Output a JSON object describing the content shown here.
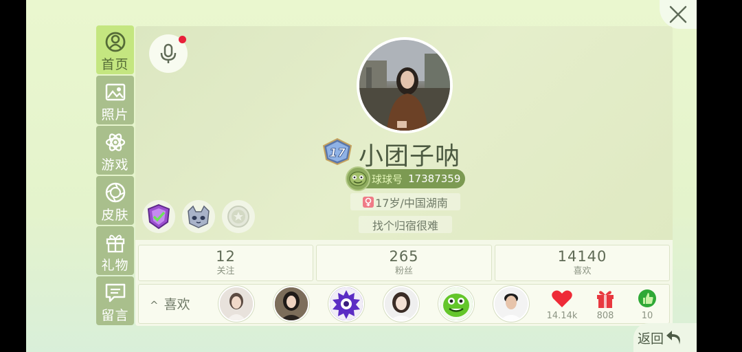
{
  "sidebar": {
    "items": [
      {
        "label": "首页",
        "icon": "user-circle-icon",
        "active": true
      },
      {
        "label": "照片",
        "icon": "photo-icon",
        "active": false
      },
      {
        "label": "游戏",
        "icon": "atom-icon",
        "active": false
      },
      {
        "label": "皮肤",
        "icon": "palette-icon",
        "active": false
      },
      {
        "label": "礼物",
        "icon": "gift-icon",
        "active": false
      },
      {
        "label": "留言",
        "icon": "message-icon",
        "active": false
      }
    ]
  },
  "profile": {
    "level": "17",
    "nickname": "小团子呐",
    "uid_tag": "球球号",
    "uid": "17387359",
    "age_location": "17岁/中国湖南",
    "bio": "找个归宿很难"
  },
  "stats": [
    {
      "value": "12",
      "label": "关注"
    },
    {
      "value": "265",
      "label": "粉丝"
    },
    {
      "value": "14140",
      "label": "喜欢"
    }
  ],
  "likes": {
    "label": "喜欢",
    "counters": [
      {
        "icon": "heart-icon",
        "value": "14.14k",
        "color": "#ee2b37"
      },
      {
        "icon": "gift-box-icon",
        "value": "808",
        "color": "#e8373e"
      },
      {
        "icon": "thumbs-up-icon",
        "value": "10",
        "color": "#2fa936"
      }
    ]
  },
  "back_label": "返回",
  "colors": {
    "accent": "#c4e680",
    "sidebar": "#a9bf8c",
    "uid_pill": "#7c9a52"
  }
}
